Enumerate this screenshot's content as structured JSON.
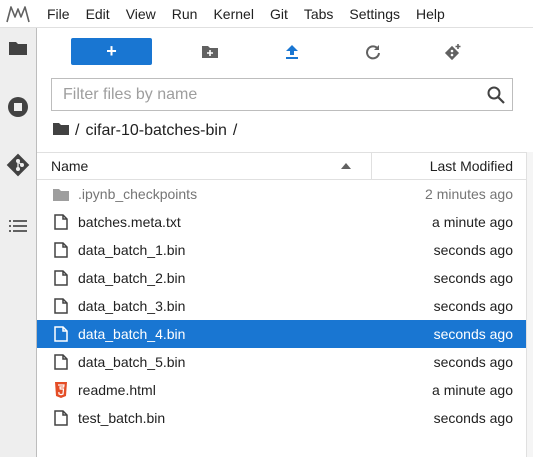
{
  "menubar": {
    "logo_icon": "jupyter-logo-icon",
    "items": [
      "File",
      "Edit",
      "View",
      "Run",
      "Kernel",
      "Git",
      "Tabs",
      "Settings",
      "Help"
    ]
  },
  "sidebar": {
    "icons": [
      "folder-icon",
      "running-stop-icon",
      "git-icon",
      "table-of-contents-icon"
    ]
  },
  "toolbar": {
    "launcher_label": "+",
    "icons": [
      "new-folder-icon",
      "upload-icon",
      "refresh-icon",
      "git-clone-icon"
    ],
    "accent_color": "#1976d2"
  },
  "filter": {
    "placeholder": "Filter files by name",
    "value": ""
  },
  "breadcrumbs": {
    "root_sep": "/",
    "crumb": "cifar-10-batches-bin",
    "trail_sep": "/"
  },
  "listing": {
    "header_name": "Name",
    "header_modified": "Last Modified",
    "files": [
      {
        "name": ".ipynb_checkpoints",
        "modified": "2 minutes ago",
        "icon": "folder-icon",
        "dim": true,
        "selected": false
      },
      {
        "name": "batches.meta.txt",
        "modified": "a minute ago",
        "icon": "file-icon",
        "dim": false,
        "selected": false
      },
      {
        "name": "data_batch_1.bin",
        "modified": "seconds ago",
        "icon": "file-icon",
        "dim": false,
        "selected": false
      },
      {
        "name": "data_batch_2.bin",
        "modified": "seconds ago",
        "icon": "file-icon",
        "dim": false,
        "selected": false
      },
      {
        "name": "data_batch_3.bin",
        "modified": "seconds ago",
        "icon": "file-icon",
        "dim": false,
        "selected": false
      },
      {
        "name": "data_batch_4.bin",
        "modified": "seconds ago",
        "icon": "file-icon",
        "dim": false,
        "selected": true
      },
      {
        "name": "data_batch_5.bin",
        "modified": "seconds ago",
        "icon": "file-icon",
        "dim": false,
        "selected": false
      },
      {
        "name": "readme.html",
        "modified": "a minute ago",
        "icon": "html5-icon",
        "dim": false,
        "selected": false
      },
      {
        "name": "test_batch.bin",
        "modified": "seconds ago",
        "icon": "file-icon",
        "dim": false,
        "selected": false
      }
    ]
  }
}
